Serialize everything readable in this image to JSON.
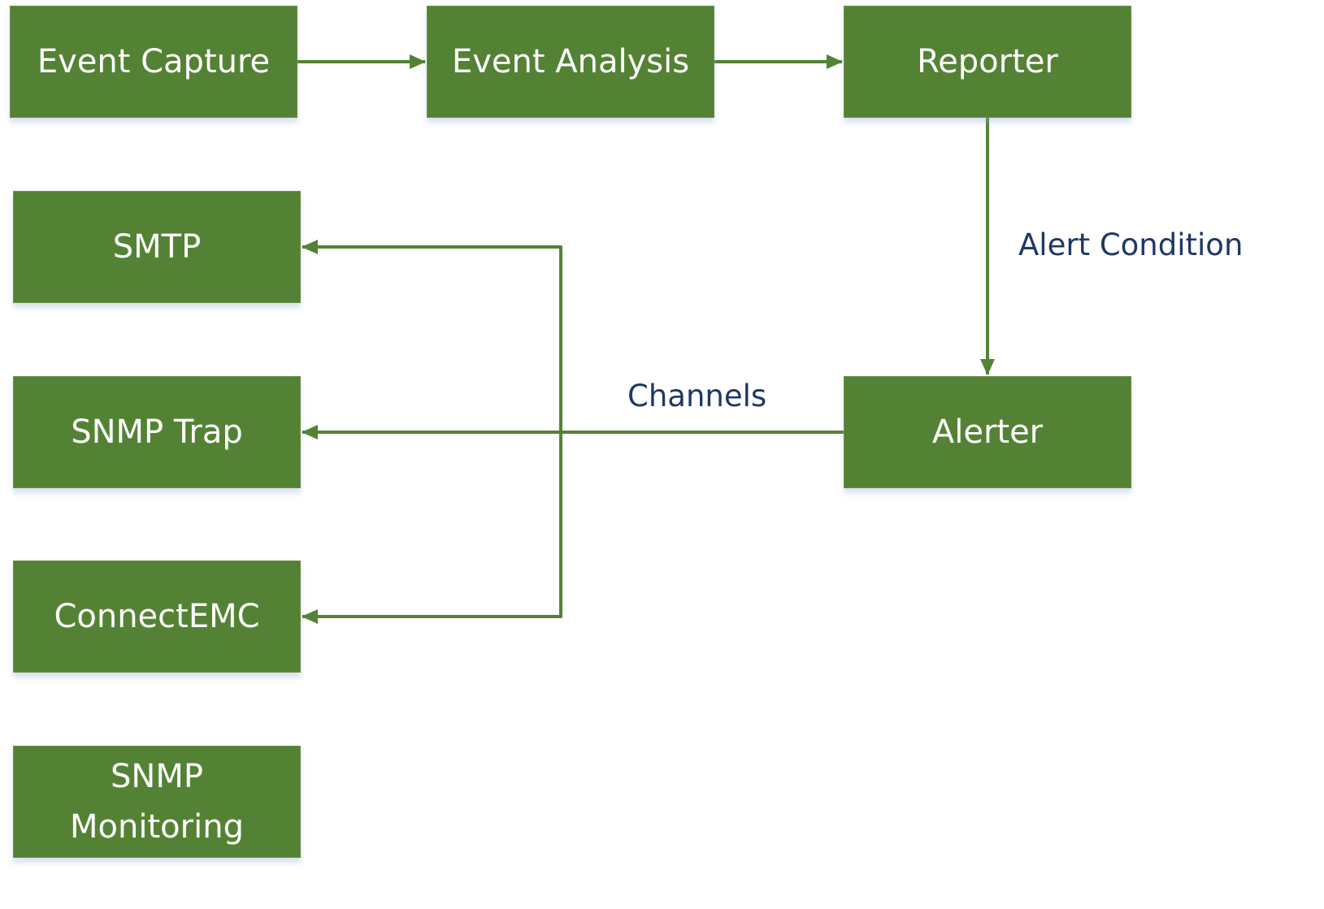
{
  "diagram": {
    "colors": {
      "node_fill": "#548235",
      "node_text": "#ffffff",
      "edge": "#548235",
      "edge_label": "#1f3864"
    },
    "nodes": {
      "event_capture": "Event Capture",
      "event_analysis": "Event Analysis",
      "reporter": "Reporter",
      "smtp": "SMTP",
      "snmp_trap": "SNMP Trap",
      "alerter": "Alerter",
      "connectemc": "ConnectEMC",
      "snmp_monitoring": "SNMP\nMonitoring"
    },
    "edge_labels": {
      "alert_condition": "Alert Condition",
      "channels": "Channels"
    },
    "edges": [
      {
        "from": "Event Capture",
        "to": "Event Analysis",
        "label": ""
      },
      {
        "from": "Event Analysis",
        "to": "Reporter",
        "label": ""
      },
      {
        "from": "Reporter",
        "to": "Alerter",
        "label": "Alert Condition"
      },
      {
        "from": "Alerter",
        "to": "SNMP Trap",
        "label": "Channels"
      },
      {
        "from": "Alerter",
        "to": "SMTP",
        "label": "Channels"
      },
      {
        "from": "Alerter",
        "to": "ConnectEMC",
        "label": "Channels"
      }
    ]
  }
}
